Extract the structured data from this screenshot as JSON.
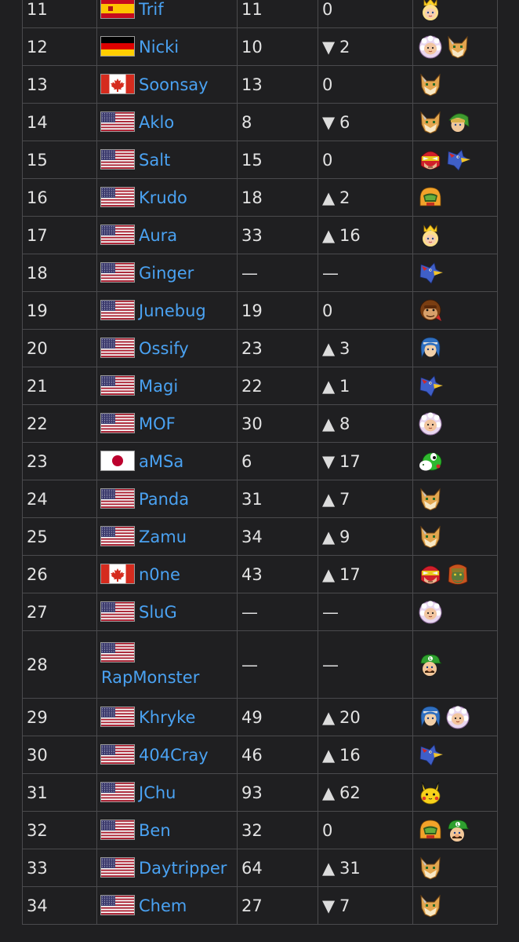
{
  "table": {
    "rows": [
      {
        "rank": "11",
        "flag": "spain-flag",
        "player": "Trif",
        "prev": "11",
        "dir": "",
        "change": "0",
        "chars": [
          "peach-icon"
        ]
      },
      {
        "rank": "12",
        "flag": "germany-flag",
        "player": "Nicki",
        "prev": "10",
        "dir": "▼",
        "change": "2",
        "chars": [
          "ice-climbers-icon",
          "fox-icon"
        ]
      },
      {
        "rank": "13",
        "flag": "canada-flag",
        "player": "Soonsay",
        "prev": "13",
        "dir": "",
        "change": "0",
        "chars": [
          "fox-icon"
        ]
      },
      {
        "rank": "14",
        "flag": "usa-flag",
        "player": "Aklo",
        "prev": "8",
        "dir": "▼",
        "change": "6",
        "chars": [
          "fox-icon",
          "link-icon"
        ]
      },
      {
        "rank": "15",
        "flag": "usa-flag",
        "player": "Salt",
        "prev": "15",
        "dir": "",
        "change": "0",
        "chars": [
          "captain-falcon-icon",
          "falco-icon"
        ]
      },
      {
        "rank": "16",
        "flag": "usa-flag",
        "player": "Krudo",
        "prev": "18",
        "dir": "▲",
        "change": "2",
        "chars": [
          "samus-icon"
        ]
      },
      {
        "rank": "17",
        "flag": "usa-flag",
        "player": "Aura",
        "prev": "33",
        "dir": "▲",
        "change": "16",
        "chars": [
          "peach-icon"
        ]
      },
      {
        "rank": "18",
        "flag": "usa-flag",
        "player": "Ginger",
        "prev": "—",
        "dir": "",
        "change": "—",
        "chars": [
          "falco-icon"
        ]
      },
      {
        "rank": "19",
        "flag": "usa-flag",
        "player": "Junebug",
        "prev": "19",
        "dir": "",
        "change": "0",
        "chars": [
          "donkey-kong-icon"
        ]
      },
      {
        "rank": "20",
        "flag": "usa-flag",
        "player": "Ossify",
        "prev": "23",
        "dir": "▲",
        "change": "3",
        "chars": [
          "marth-icon"
        ]
      },
      {
        "rank": "21",
        "flag": "usa-flag",
        "player": "Magi",
        "prev": "22",
        "dir": "▲",
        "change": "1",
        "chars": [
          "falco-icon"
        ]
      },
      {
        "rank": "22",
        "flag": "usa-flag",
        "player": "MOF",
        "prev": "30",
        "dir": "▲",
        "change": "8",
        "chars": [
          "ice-climbers-icon"
        ]
      },
      {
        "rank": "23",
        "flag": "japan-flag",
        "player": "aMSa",
        "prev": "6",
        "dir": "▼",
        "change": "17",
        "chars": [
          "yoshi-icon"
        ]
      },
      {
        "rank": "24",
        "flag": "usa-flag",
        "player": "Panda",
        "prev": "31",
        "dir": "▲",
        "change": "7",
        "chars": [
          "fox-icon"
        ]
      },
      {
        "rank": "25",
        "flag": "usa-flag",
        "player": "Zamu",
        "prev": "34",
        "dir": "▲",
        "change": "9",
        "chars": [
          "fox-icon"
        ]
      },
      {
        "rank": "26",
        "flag": "canada-flag",
        "player": "n0ne",
        "prev": "43",
        "dir": "▲",
        "change": "17",
        "chars": [
          "captain-falcon-icon",
          "ganondorf-icon"
        ]
      },
      {
        "rank": "27",
        "flag": "usa-flag",
        "player": "SluG",
        "prev": "—",
        "dir": "",
        "change": "—",
        "chars": [
          "ice-climbers-icon"
        ]
      },
      {
        "rank": "28",
        "flag": "usa-flag",
        "player": "RapMonster",
        "prev": "—",
        "dir": "",
        "change": "—",
        "chars": [
          "luigi-icon"
        ]
      },
      {
        "rank": "29",
        "flag": "usa-flag",
        "player": "Khryke",
        "prev": "49",
        "dir": "▲",
        "change": "20",
        "chars": [
          "marth-icon",
          "ice-climbers-icon"
        ]
      },
      {
        "rank": "30",
        "flag": "usa-flag",
        "player": "404Cray",
        "prev": "46",
        "dir": "▲",
        "change": "16",
        "chars": [
          "falco-icon"
        ]
      },
      {
        "rank": "31",
        "flag": "usa-flag",
        "player": "JChu",
        "prev": "93",
        "dir": "▲",
        "change": "62",
        "chars": [
          "pikachu-icon"
        ]
      },
      {
        "rank": "32",
        "flag": "usa-flag",
        "player": "Ben",
        "prev": "32",
        "dir": "",
        "change": "0",
        "chars": [
          "samus-icon",
          "luigi-icon"
        ]
      },
      {
        "rank": "33",
        "flag": "usa-flag",
        "player": "Daytripper",
        "prev": "64",
        "dir": "▲",
        "change": "31",
        "chars": [
          "fox-icon"
        ]
      },
      {
        "rank": "34",
        "flag": "usa-flag",
        "player": "Chem",
        "prev": "27",
        "dir": "▼",
        "change": "7",
        "chars": [
          "fox-icon"
        ]
      }
    ]
  }
}
